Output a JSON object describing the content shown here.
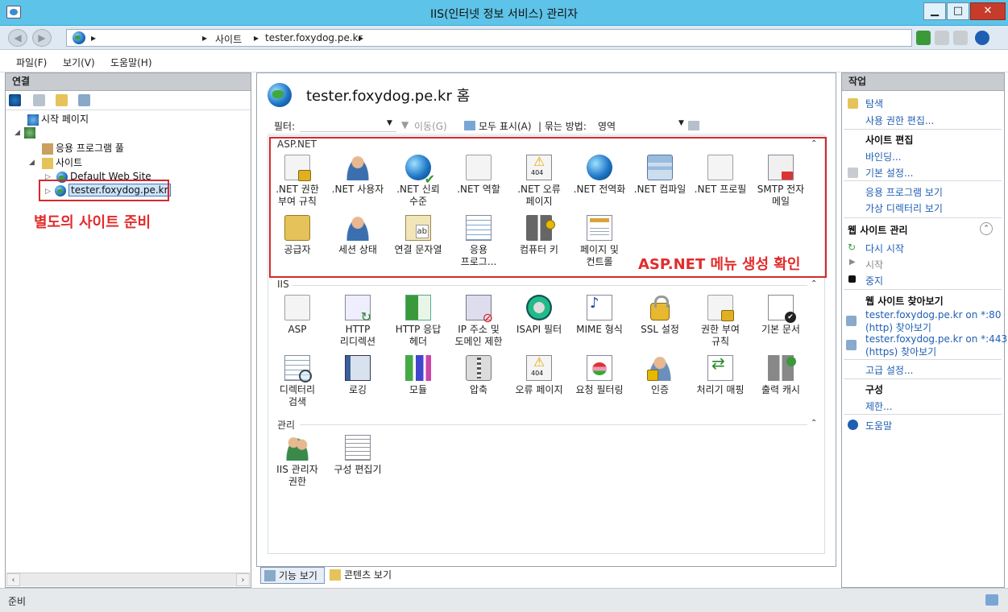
{
  "window": {
    "title": "IIS(인터넷 정보 서비스) 관리자",
    "min": "▁",
    "max": "□",
    "close": "✕"
  },
  "address": {
    "sep1": "▸",
    "sep2": "▸",
    "site": "사이트",
    "sep3": "▸",
    "host": "tester.foxydog.pe.kr",
    "sep4": "▸"
  },
  "menu": [
    "파일(F)",
    "보기(V)",
    "도움말(H)"
  ],
  "left": {
    "header": "연결",
    "tree": {
      "start": "시작 페이지",
      "root": "",
      "apppool": "응용 프로그램 풀",
      "sites": "사이트",
      "default": "Default Web Site",
      "tester": "tester.foxydog.pe.kr"
    }
  },
  "annotations": {
    "left": "별도의 사이트 준비",
    "center": "ASP.NET 메뉴 생성 확인"
  },
  "main": {
    "title": "tester.foxydog.pe.kr 홈",
    "filter": {
      "label": "필터:",
      "go": "이동(G)",
      "showall": "모두 표시(A)",
      "groupby": "| 묶는 방법:",
      "groupval": "영역"
    },
    "sections": {
      "aspnet": "ASP.NET",
      "iis": "IIS",
      "mgmt": "관리"
    },
    "aspnet": [
      [
        ".NET 권한",
        "부여 규칙"
      ],
      [
        ".NET 사용자",
        ""
      ],
      [
        ".NET 신뢰",
        "수준"
      ],
      [
        ".NET 역할",
        ""
      ],
      [
        ".NET 오류",
        "페이지"
      ],
      [
        ".NET 전역화",
        ""
      ],
      [
        ".NET 컴파일",
        ""
      ],
      [
        ".NET 프로필",
        ""
      ],
      [
        "SMTP 전자",
        "메일"
      ],
      [
        "공급자",
        ""
      ],
      [
        "세션 상태",
        ""
      ],
      [
        "연결 문자열",
        ""
      ],
      [
        "응용",
        "프로그..."
      ],
      [
        "컴퓨터 키",
        ""
      ],
      [
        "페이지 및",
        "컨트롤"
      ]
    ],
    "iis": [
      [
        "ASP",
        ""
      ],
      [
        "HTTP",
        "리디렉션"
      ],
      [
        "HTTP 응답",
        "헤더"
      ],
      [
        "IP 주소 및",
        "도메인 제한"
      ],
      [
        "ISAPI 필터",
        ""
      ],
      [
        "MIME 형식",
        ""
      ],
      [
        "SSL 설정",
        ""
      ],
      [
        "권한 부여",
        "규칙"
      ],
      [
        "기본 문서",
        ""
      ],
      [
        "디렉터리",
        "검색"
      ],
      [
        "로깅",
        ""
      ],
      [
        "모듈",
        ""
      ],
      [
        "압축",
        ""
      ],
      [
        "오류 페이지",
        ""
      ],
      [
        "요청 필터링",
        ""
      ],
      [
        "인증",
        ""
      ],
      [
        "처리기 매핑",
        ""
      ],
      [
        "출력 캐시",
        ""
      ]
    ],
    "mgmt": [
      [
        "IIS 관리자",
        "권한"
      ],
      [
        "구성 편집기",
        ""
      ]
    ],
    "tabs": {
      "features": "기능 보기",
      "content": "콘텐츠 보기"
    }
  },
  "right": {
    "header": "작업",
    "explore": "탐색",
    "editperm": "사용 권한 편집...",
    "siteedit": "사이트 편집",
    "bindings": "바인딩...",
    "basic": "기본 설정...",
    "viewapps": "응용 프로그램 보기",
    "viewvdirs": "가상 디렉터리 보기",
    "manage": "웹 사이트 관리",
    "restart": "다시 시작",
    "start": "시작",
    "stop": "중지",
    "browse": "웹 사이트 찾아보기",
    "b80a": "tester.foxydog.pe.kr on *:80",
    "b80b": "(http) 찾아보기",
    "b443a": "tester.foxydog.pe.kr on *:443",
    "b443b": "(https) 찾아보기",
    "advanced": "고급 설정...",
    "config": "구성",
    "limits": "제한...",
    "help": "도움말"
  },
  "status": {
    "text": "준비"
  }
}
